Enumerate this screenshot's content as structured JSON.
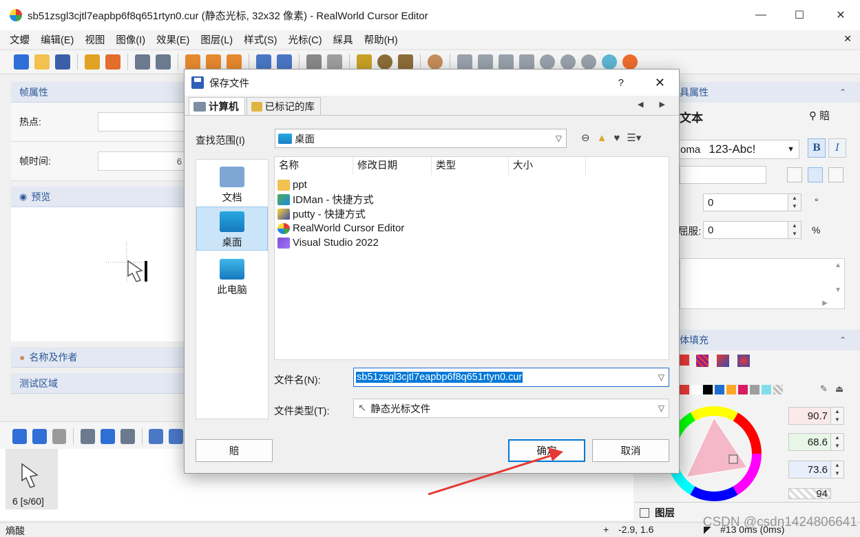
{
  "window": {
    "title": "sb51zsgl3cjtl7eapbp6f8q651rtyn0.cur (静态光标, 32x32 像素) - RealWorld Cursor Editor",
    "minimize": "—",
    "maximize": "☐",
    "close": "✕"
  },
  "menu": {
    "items": [
      "文蠳",
      "编辑(E)",
      "视图",
      "图像(I)",
      "效果(E)",
      "图层(L)",
      "样式(S)",
      "光标(C)",
      "綵具",
      "帮助(H)"
    ],
    "close": "✕"
  },
  "left_panel": {
    "frame_props_header": "帧属性",
    "hotspot_label": "热点:",
    "frame_time_label": "帧时间:",
    "frame_time_value": "6",
    "preview_header": "预览",
    "author_header": "名称及作者",
    "test_header": "测试区域"
  },
  "frames": {
    "frame_label": "6 [s/60]"
  },
  "right_panel": {
    "props_header": "具属性",
    "text_label": "文本",
    "paste_label": "賠 ",
    "font_name": "oma",
    "font_sample": "123-Abc!",
    "bold": "B",
    "italic": "I",
    "angle_value": "0",
    "angle_unit": "°",
    "overcome_label": "屈服:",
    "overcome_value": "0",
    "overcome_unit": "%",
    "fill_header": "体填充",
    "color_values": [
      "90.7",
      "68.6",
      "73.6",
      "94"
    ],
    "layers_header": "图层"
  },
  "statusbar": {
    "left": "熵酸",
    "coords": "-2.9, 1.6",
    "frame_info": "#13 0ms (0ms)"
  },
  "watermark": "CSDN @csdn1424806641",
  "dialog": {
    "title": "保存文件",
    "help": "?",
    "close": "✕",
    "tabs": [
      "计算机",
      "已标记的库"
    ],
    "tab_arrows": "◀ ▶",
    "look_in_label": "查找范围(I)",
    "look_in_value": "桌面",
    "places": [
      "文档",
      "桌面",
      "此电脑"
    ],
    "columns": [
      "名称",
      "修改日期",
      "类型",
      "大小"
    ],
    "files": [
      "ppt",
      "IDMan - 快捷方式",
      "putty - 快捷方式",
      "RealWorld Cursor Editor",
      "Visual Studio 2022"
    ],
    "file_name_label": "文件名(N):",
    "file_name_value": "sb51zsgl3cjtl7eapbp6f8q651rtyn0.cur",
    "file_type_label": "文件类型(T):",
    "file_type_value": "静态光标文件",
    "paste_button": "賠 ",
    "ok_button": "确定",
    "cancel_button": "取消"
  },
  "colors": {
    "accent": "#0078d7",
    "annotation_arrow": "#e53935",
    "panel_header_text": "#2b5797"
  }
}
